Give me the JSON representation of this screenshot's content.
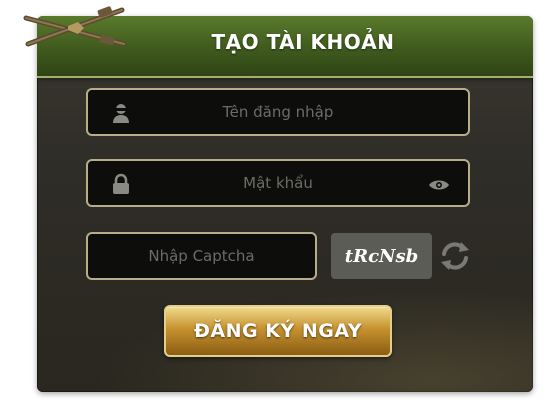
{
  "dialog": {
    "title": "TẠO TÀI KHOẢN"
  },
  "form": {
    "username_placeholder": "Tên đăng nhập",
    "password_placeholder": "Mật khẩu",
    "captcha_placeholder": "Nhập Captcha",
    "captcha_code": "tRcNsb",
    "submit_label": "ĐĂNG KÝ NGAY"
  },
  "icons": {
    "username": "user-ninja-icon",
    "password": "lock-icon",
    "show_password": "eye-icon",
    "refresh_captcha": "refresh-icon",
    "logo": "crossed-rifles-logo"
  },
  "colors": {
    "header": "#3f5a1d",
    "panel": "#2f2d27",
    "field_border": "#b8ad8b",
    "button_gold": "#c6922f"
  }
}
